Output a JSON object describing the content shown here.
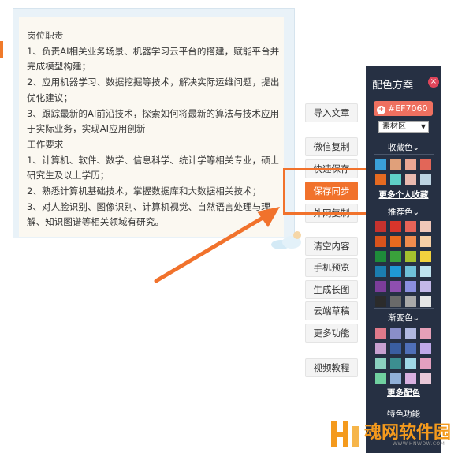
{
  "editor": {
    "lines": [
      "岗位职责",
      "1、负责AI相关业务场景、机器学习云平台的搭建，赋能平台并完成模型构建；",
      "2、应用机器学习、数据挖掘等技术，解决实际运维问题，提出优化建议；",
      "3、跟踪最新的AI前沿技术，探索如何将最新的算法与技术应用于实际业务，实现AI应用创新",
      "工作要求",
      "1、计算机、软件、数学、信息科学、统计学等相关专业，硕士研究生及以上学历；",
      "2、熟悉计算机基础技术，掌握数据库和大数据相关技术；",
      "3、对人脸识别、图像识别、计算机视觉、自然语言处理与理解、知识图谱等相关领域有研究。"
    ]
  },
  "toolbar": {
    "import": "导入文章",
    "wechat_copy": "微信复制",
    "quick_save": "快速保存",
    "save_sync": "保存同步",
    "external_copy": "外网复制",
    "clear": "清空内容",
    "phone_preview": "手机预览",
    "long_image": "生成长图",
    "cloud_draft": "云端草稿",
    "more": "更多功能",
    "video_tutorial": "视频教程"
  },
  "panel": {
    "title": "配色方案",
    "close_icon": "×",
    "current_color": "#EF7060",
    "select_value": "素材区",
    "favorites_title": "收藏色",
    "favorites_link": "更多个人收藏",
    "recommended_title": "推荐色",
    "gradient_title": "渐变色",
    "more_colors_link": "更多配色",
    "bottom_label": "特色功能"
  },
  "colors": {
    "accent": "#F1722C",
    "panel_bg": "#263043",
    "favorites": [
      "#3aa0d8",
      "#e0a07a",
      "#e9a694",
      "#e26658",
      "#e56a21",
      "#5fd0c8",
      "#eabab0",
      "#bcd3e2"
    ],
    "recommended": [
      "#c6322e",
      "#d8352b",
      "#e66358",
      "#f0c7b8",
      "#d9531c",
      "#e96a1f",
      "#f08c4e",
      "#f6cfa6",
      "#1e8b3a",
      "#3aa13b",
      "#a4c02e",
      "#f2d23e",
      "#1b7db0",
      "#1f9ad6",
      "#6fc0d8",
      "#bfe3ef",
      "#7b3d9a",
      "#8e4fb0",
      "#8a8fe0",
      "#c3b8e8",
      "#2b2b2b",
      "#6a6a6a",
      "#a9a9a9",
      "#e6e6e6"
    ],
    "gradient": [
      "#e07a8a",
      "#8a8ec8",
      "#b0b8e0",
      "#e6a0b8",
      "#c8a0d0",
      "#3a5ea0",
      "#4f6fb8",
      "#c0a8e8",
      "#8bd0c0",
      "#3c8e90",
      "#a0d8e8",
      "#e4a0c0",
      "#70d0a0",
      "#90b0d8",
      "#d8b0e0",
      "#e8c8d8"
    ]
  },
  "watermark": {
    "text": "魂网软件园",
    "url": "WWW.HNWDW.COM"
  }
}
